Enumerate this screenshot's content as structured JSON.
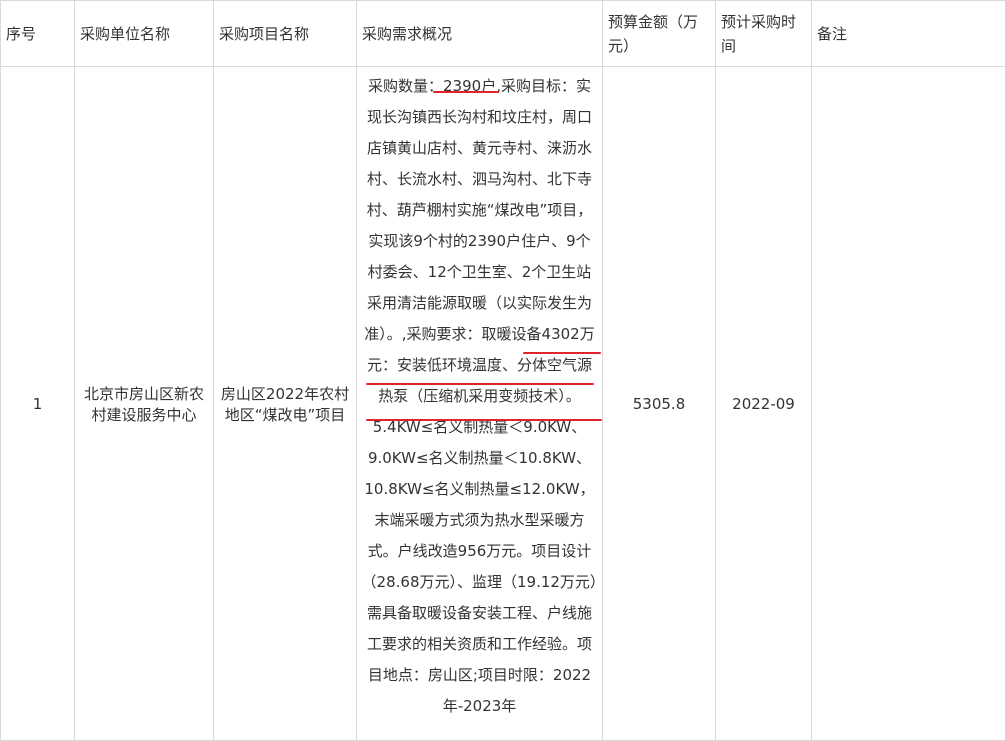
{
  "headers": [
    "序号",
    "采购单位名称",
    "采购项目名称",
    "采购需求概况",
    "预算金额（万元）",
    "预计采购时间",
    "备注"
  ],
  "row": {
    "index": "1",
    "unit": "北京市房山区新农村建设服务中心",
    "project": "房山区2022年农村地区“煤改电”项目",
    "description": "采购数量：2390户,采购目标：实现长沟镇西长沟村和坟庄村，周口店镇黄山店村、黄元寺村、涞沥水村、长流水村、泗马沟村、北下寺村、葫芦棚村实施“煤改电”项目，实现该9个村的2390户住户、9个村委会、12个卫生室、2个卫生站采用清洁能源取暖（以实际发生为准）。,采购要求：取暖设备4302万元：安装低环境温度、分体空气源热泵（压缩机采用变频技术）。5.4KW≤名义制热量＜9.0KW、9.0KW≤名义制热量＜10.8KW、10.8KW≤名义制热量≤12.0KW，末端采暖方式须为热水型采暖方式。户线改造956万元。项目设计（28.68万元）、监理（19.12万元）需具备取暖设备安装工程、户线施工要求的相关资质和工作经验。项目地点：房山区;项目时限：2022年-2023年",
    "budget": "5305.8",
    "time": "2022-09",
    "remark": ""
  },
  "colors": {
    "border": "#d9d9d9",
    "text": "#333333",
    "underline": "#e0242b"
  }
}
